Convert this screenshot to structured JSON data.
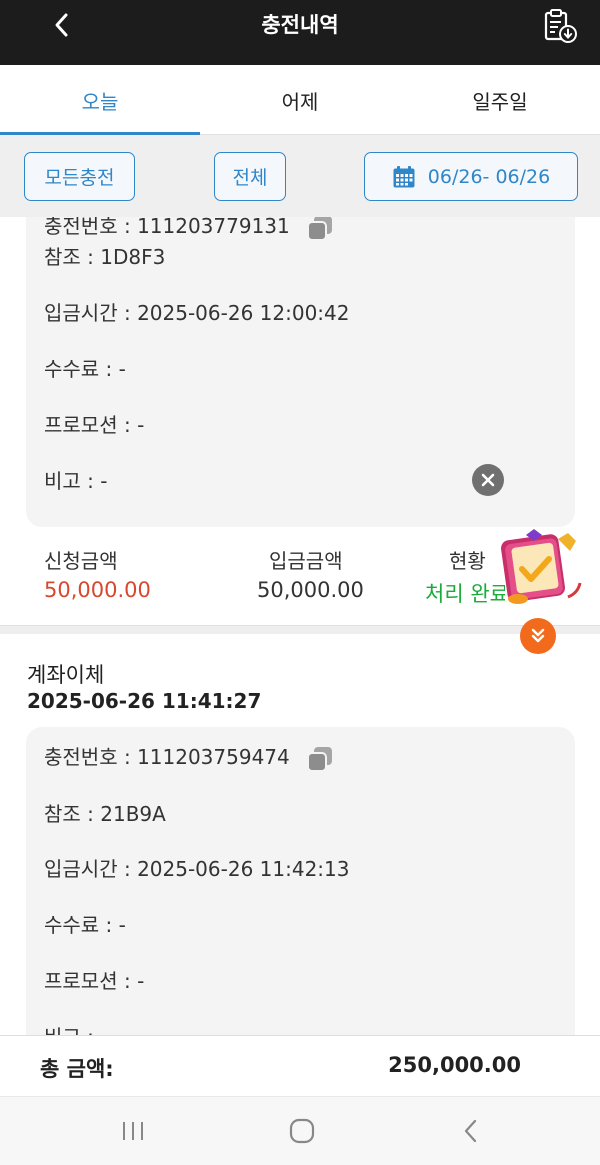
{
  "header": {
    "title": "충전내역"
  },
  "tabs": [
    {
      "label": "오늘",
      "active": true
    },
    {
      "label": "어제",
      "active": false
    },
    {
      "label": "일주일",
      "active": false
    }
  ],
  "filters": {
    "type_label": "모든충전",
    "status_label": "전체",
    "date_range": "06/26- 06/26"
  },
  "records": [
    {
      "deposit_no_label": "충전번호",
      "deposit_no": "111203779131",
      "ref_label": "참조",
      "ref": "1D8F3",
      "deposit_time_label": "입금시간",
      "deposit_time": "2025-06-26 12:00:42",
      "fee_label": "수수료",
      "fee": "-",
      "promo_label": "프로모션",
      "promo": "-",
      "note_label": "비고",
      "note": "-",
      "requested_label": "신청금액",
      "requested": "50,000.00",
      "deposited_label": "입금금액",
      "deposited": "50,000.00",
      "status_label": "현황",
      "status": "처리 완료"
    },
    {
      "method": "계좌이체",
      "datetime": "2025-06-26 11:41:27",
      "deposit_no_label": "충전번호",
      "deposit_no": "111203759474",
      "ref_label": "참조",
      "ref": "21B9A",
      "deposit_time_label": "입금시간",
      "deposit_time": "2025-06-26 11:42:13",
      "fee_label": "수수료",
      "fee": "-",
      "promo_label": "프로모션",
      "promo": "-",
      "note_label": "비고",
      "note": ""
    }
  ],
  "footer": {
    "total_label": "총 금액:",
    "total_value": "250,000.00"
  },
  "colors": {
    "accent": "#2f86c9",
    "requested": "#d8482f",
    "status_done": "#1aab3b",
    "header_bg": "#1c1c1c"
  }
}
